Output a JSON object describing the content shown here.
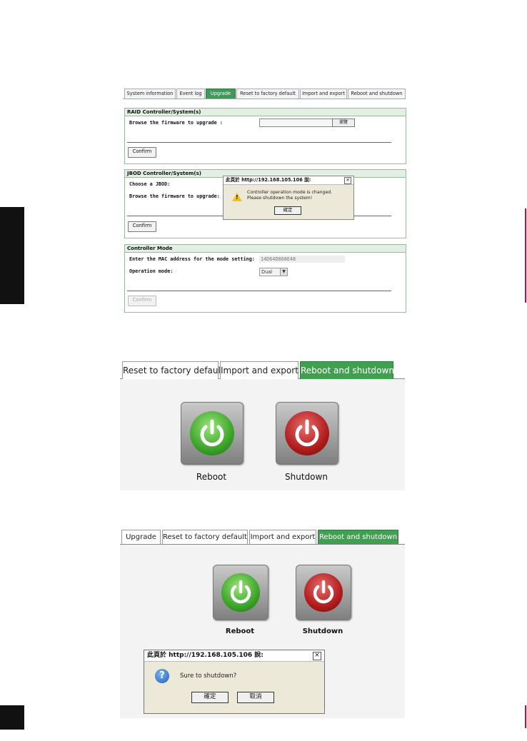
{
  "panel1": {
    "tabs": [
      {
        "label": "System information"
      },
      {
        "label": "Event log"
      },
      {
        "label": "Upgrade"
      },
      {
        "label": "Reset to factory default"
      },
      {
        "label": "Import and export"
      },
      {
        "label": "Reboot and shutdown"
      }
    ],
    "raid": {
      "header": "RAID Controller/System(s)",
      "browse_label": "Browse the firmware to upgrade :",
      "browse_button": "瀏覽",
      "confirm": "Confirm"
    },
    "jbod": {
      "header": "JBOD Controller/System(s)",
      "choose_label": "Choose a JBOD:",
      "browse_label": "Browse the firmware to upgrade:",
      "confirm": "Confirm"
    },
    "mode": {
      "header": "Controller Mode",
      "mac_label": "Enter the MAC address for the mode setting:",
      "mac_value": "14D64D868E48",
      "op_label": "Operation mode:",
      "op_value": "Dual",
      "confirm": "Confirm"
    },
    "dialog": {
      "title": "此頁於 http://192.168.105.106 說:",
      "line1": "Controller operation mode is changed.",
      "line2": "Please shutdown the system!",
      "ok": "確定"
    }
  },
  "panel2": {
    "tabs": [
      {
        "label": "Reset to factory default"
      },
      {
        "label": "Import and export"
      },
      {
        "label": "Reboot and shutdown"
      }
    ],
    "reboot_label": "Reboot",
    "shutdown_label": "Shutdown"
  },
  "panel3": {
    "tabs": [
      {
        "label": "Upgrade"
      },
      {
        "label": "Reset to factory default"
      },
      {
        "label": "Import and export"
      },
      {
        "label": "Reboot and shutdown"
      }
    ],
    "reboot_label": "Reboot",
    "shutdown_label": "Shutdown",
    "dialog": {
      "title": "此頁於 http://192.168.105.106 說:",
      "message": "Sure to shutdown?",
      "ok": "確定",
      "cancel": "取消"
    }
  },
  "colors": {
    "active_tab": "#3fa04f",
    "section_border": "#9bb79f",
    "side_tab": "#111111",
    "edge_accent": "#c8102e"
  }
}
